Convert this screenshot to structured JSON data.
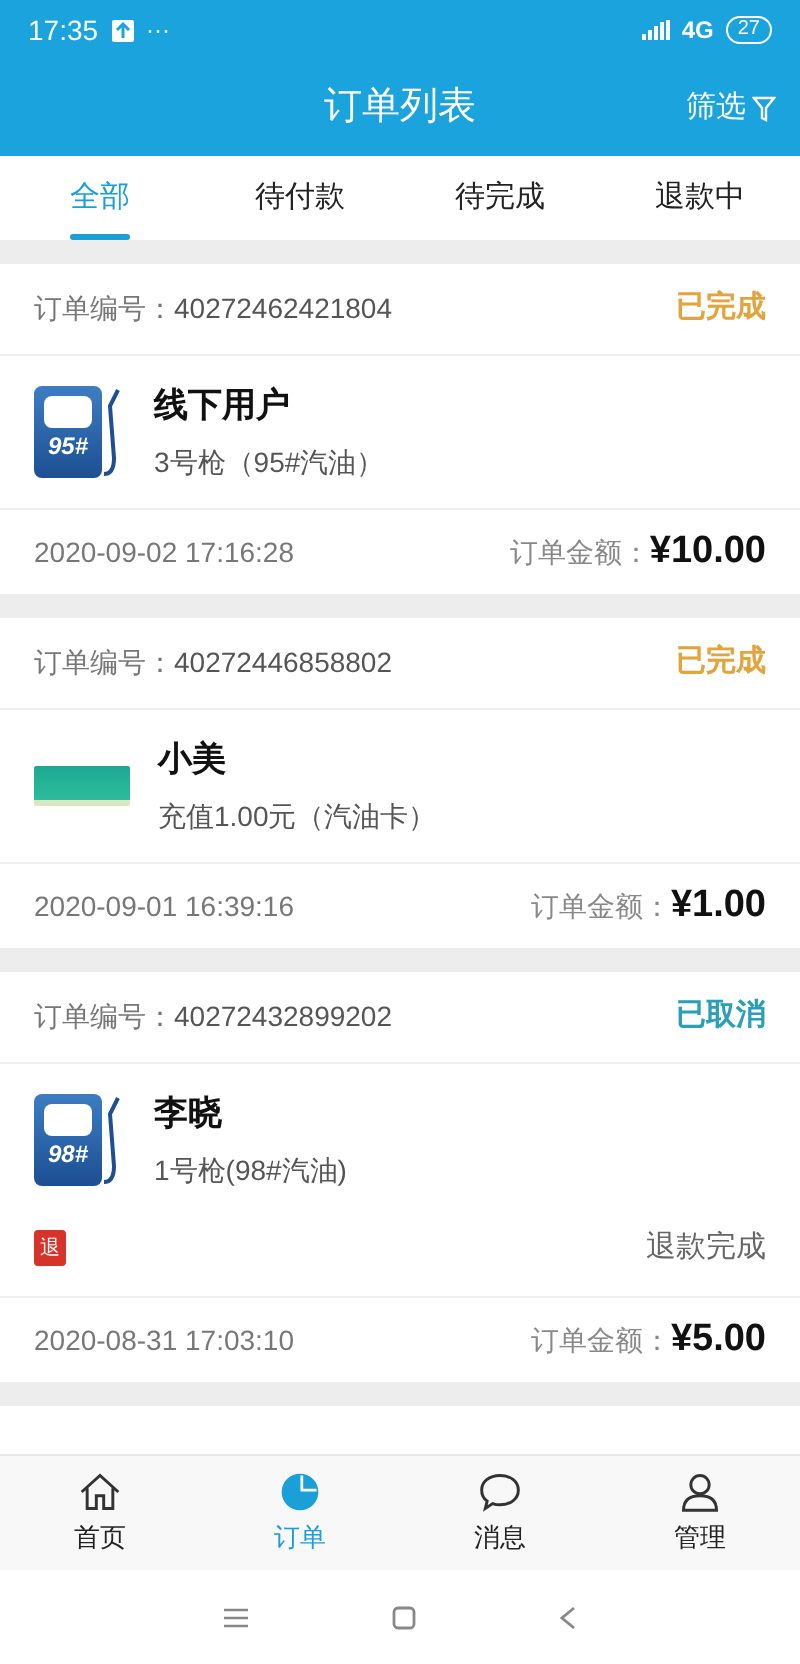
{
  "status_bar": {
    "time": "17:35",
    "dots": "···",
    "network": "4G",
    "battery": "27"
  },
  "header": {
    "title": "订单列表",
    "filter": "筛选"
  },
  "tabs": [
    {
      "label": "全部",
      "selected": true
    },
    {
      "label": "待付款",
      "selected": false
    },
    {
      "label": "待完成",
      "selected": false
    },
    {
      "label": "退款中",
      "selected": false
    }
  ],
  "orders": [
    {
      "number_label": "订单编号：",
      "number": "40272462421804",
      "status": "已完成",
      "color": "#e3a33d",
      "kind": "pump",
      "grade": "95#",
      "name": "线下用户",
      "detail": "3号枪（95#汽油）",
      "time": "2020-09-02 17:16:28",
      "amount_label": "订单金额：",
      "amount": "¥10.00"
    },
    {
      "number_label": "订单编号：",
      "number": "40272446858802",
      "status": "已完成",
      "color": "#e3a33d",
      "kind": "card",
      "name": "小美",
      "detail": "充值1.00元（汽油卡）",
      "time": "2020-09-01 16:39:16",
      "amount_label": "订单金额：",
      "amount": "¥1.00"
    },
    {
      "number_label": "订单编号：",
      "number": "40272432899202",
      "status": "已取消",
      "color": "#2a9fb5",
      "kind": "pump",
      "grade": "98#",
      "name": "李晓",
      "detail": "1号枪(98#汽油)",
      "refund_badge": "退",
      "refund": "退款完成",
      "time": "2020-08-31 17:03:10",
      "amount_label": "订单金额：",
      "amount": "¥5.00"
    }
  ],
  "tab_bar": [
    {
      "kind": "home",
      "label": "首页",
      "selected": false
    },
    {
      "kind": "orders",
      "label": "订单",
      "selected": true
    },
    {
      "kind": "messages",
      "label": "消息",
      "selected": false
    },
    {
      "kind": "profile",
      "label": "管理",
      "selected": false
    }
  ]
}
